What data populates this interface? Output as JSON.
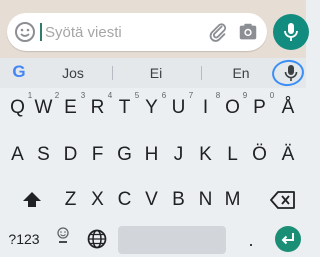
{
  "composer": {
    "placeholder": "Syötä viesti",
    "emoji_icon": "smiley-icon",
    "attach_icon": "paperclip-icon",
    "camera_icon": "camera-icon",
    "mic_icon": "microphone-icon"
  },
  "suggestions": {
    "logo": "G",
    "items": [
      "Jos",
      "Ei",
      "En"
    ],
    "voice_icon": "microphone-icon"
  },
  "keyboard": {
    "row1": [
      {
        "key": "Q",
        "hint": "1"
      },
      {
        "key": "W",
        "hint": "2"
      },
      {
        "key": "E",
        "hint": "3"
      },
      {
        "key": "R",
        "hint": "4"
      },
      {
        "key": "T",
        "hint": "5"
      },
      {
        "key": "Y",
        "hint": "6"
      },
      {
        "key": "U",
        "hint": "7"
      },
      {
        "key": "I",
        "hint": "8"
      },
      {
        "key": "O",
        "hint": "9"
      },
      {
        "key": "P",
        "hint": "0"
      },
      {
        "key": "Å",
        "hint": ""
      }
    ],
    "row2": [
      "A",
      "S",
      "D",
      "F",
      "G",
      "H",
      "J",
      "K",
      "L",
      "Ö",
      "Ä"
    ],
    "row3": [
      "Z",
      "X",
      "C",
      "V",
      "B",
      "N",
      "M"
    ],
    "bottom": {
      "numbers": "?123",
      "period": "."
    }
  },
  "colors": {
    "accent": "#128c7e",
    "enter": "#1b8f76",
    "voice_highlight": "#3a8ef6",
    "keyboard_bg": "#eceff1"
  }
}
